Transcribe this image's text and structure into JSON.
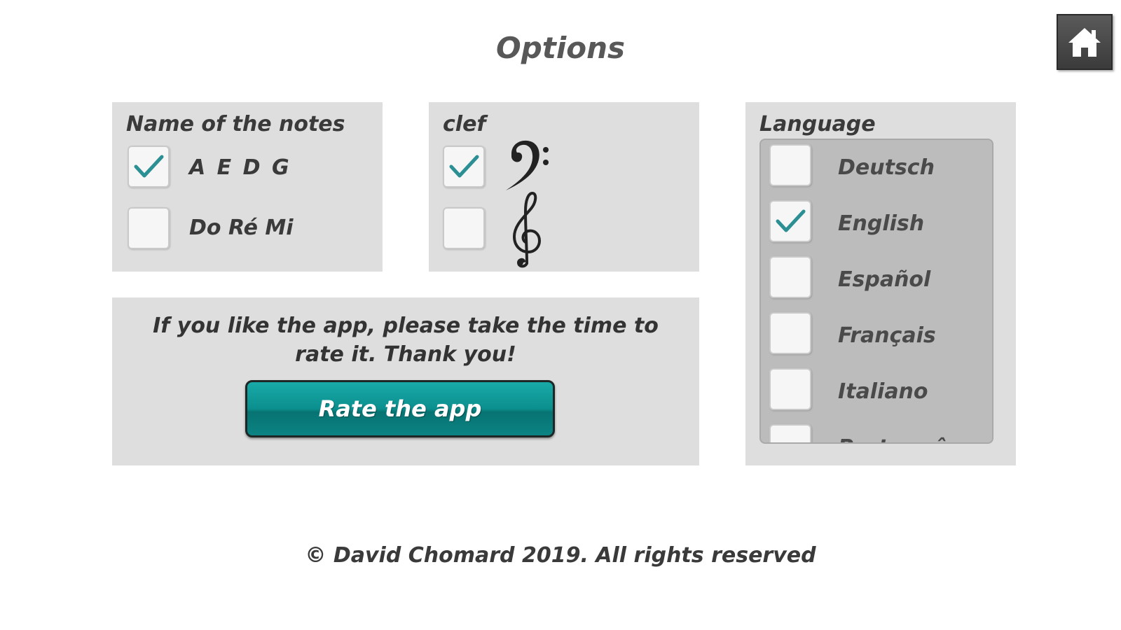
{
  "page": {
    "title": "Options",
    "footer": "© David Chomard 2019. All rights reserved"
  },
  "home_button": {
    "icon": "home-icon"
  },
  "notes_panel": {
    "label": "Name of the notes",
    "options": [
      {
        "label": "A E D G",
        "checked": true
      },
      {
        "label": "Do Ré Mi",
        "checked": false
      }
    ]
  },
  "clef_panel": {
    "label": "clef",
    "options": [
      {
        "icon": "bass-clef-icon",
        "checked": true
      },
      {
        "icon": "treble-clef-icon",
        "checked": false
      }
    ]
  },
  "rate_panel": {
    "text": "If you like the app, please take the time to rate it. Thank you!",
    "button_label": "Rate the app"
  },
  "language_panel": {
    "label": "Language",
    "options": [
      {
        "label": "Deutsch",
        "checked": false
      },
      {
        "label": "English",
        "checked": true
      },
      {
        "label": "Español",
        "checked": false
      },
      {
        "label": "Français",
        "checked": false
      },
      {
        "label": "Italiano",
        "checked": false
      },
      {
        "label": "Português",
        "checked": false
      }
    ]
  },
  "colors": {
    "accent": "#1a9c9b",
    "checkmark": "#2b8f93",
    "panel_bg": "#dedede",
    "list_bg": "#bcbcbc"
  }
}
